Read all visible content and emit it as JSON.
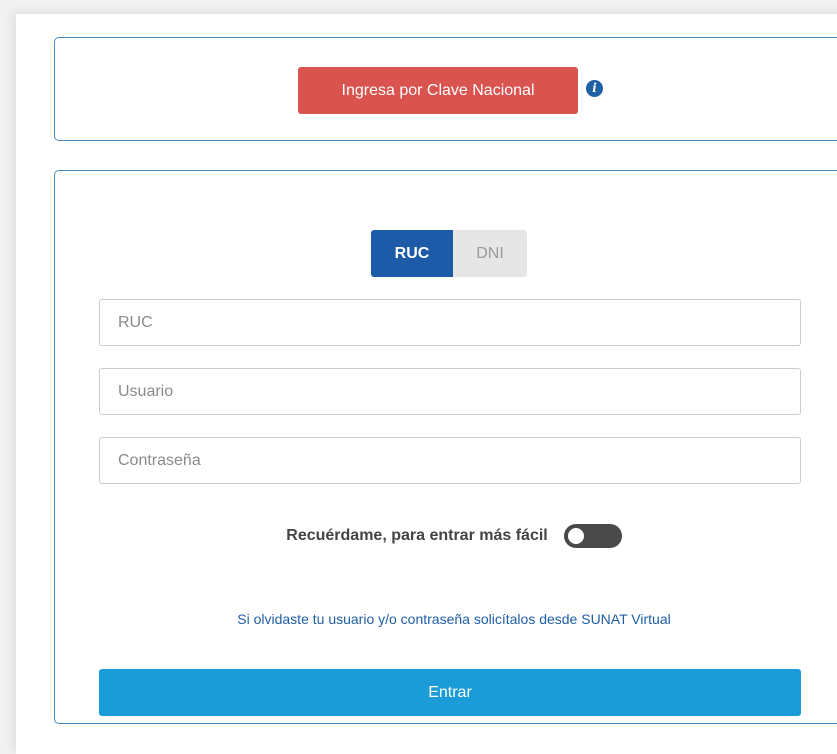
{
  "top_panel": {
    "clave_button_label": "Ingresa por Clave Nacional",
    "info_icon": "info-circle-icon",
    "clave_button_color": "#d9534f"
  },
  "login": {
    "tabs": [
      {
        "label": "RUC",
        "active": true
      },
      {
        "label": "DNI",
        "active": false
      }
    ],
    "fields": {
      "ruc_placeholder": "RUC",
      "usuario_placeholder": "Usuario",
      "password_placeholder": "Contraseña"
    },
    "remember_label": "Recuérdame, para entrar más fácil",
    "remember_on": false,
    "forgot_text": "Si olvidaste tu usuario y/o contraseña solicítalos desde SUNAT Virtual",
    "submit_label": "Entrar",
    "active_tab_color": "#1d5aa8",
    "submit_color": "#1b9bd7"
  }
}
